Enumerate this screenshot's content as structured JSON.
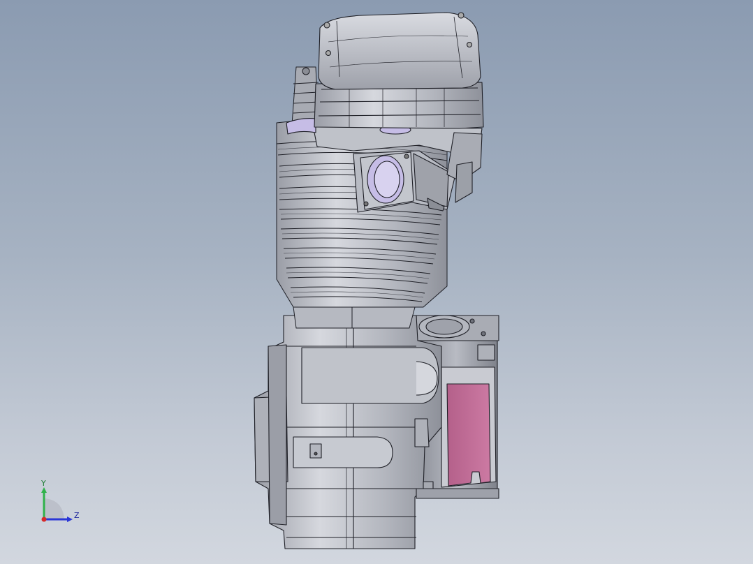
{
  "viewport": {
    "background_top": "#8b9bb1",
    "background_bottom": "#d2d7df"
  },
  "model": {
    "body_color": "#b9bcc4",
    "edge_color": "#1e1f26",
    "accent_pink": "#c4709a",
    "accent_lilac": "#c6bde6"
  },
  "triad": {
    "y_label": "Y",
    "z_label": "Z",
    "y_color": "#2fb24a",
    "z_color": "#2a36d6",
    "x_color": "#d62a2a"
  }
}
